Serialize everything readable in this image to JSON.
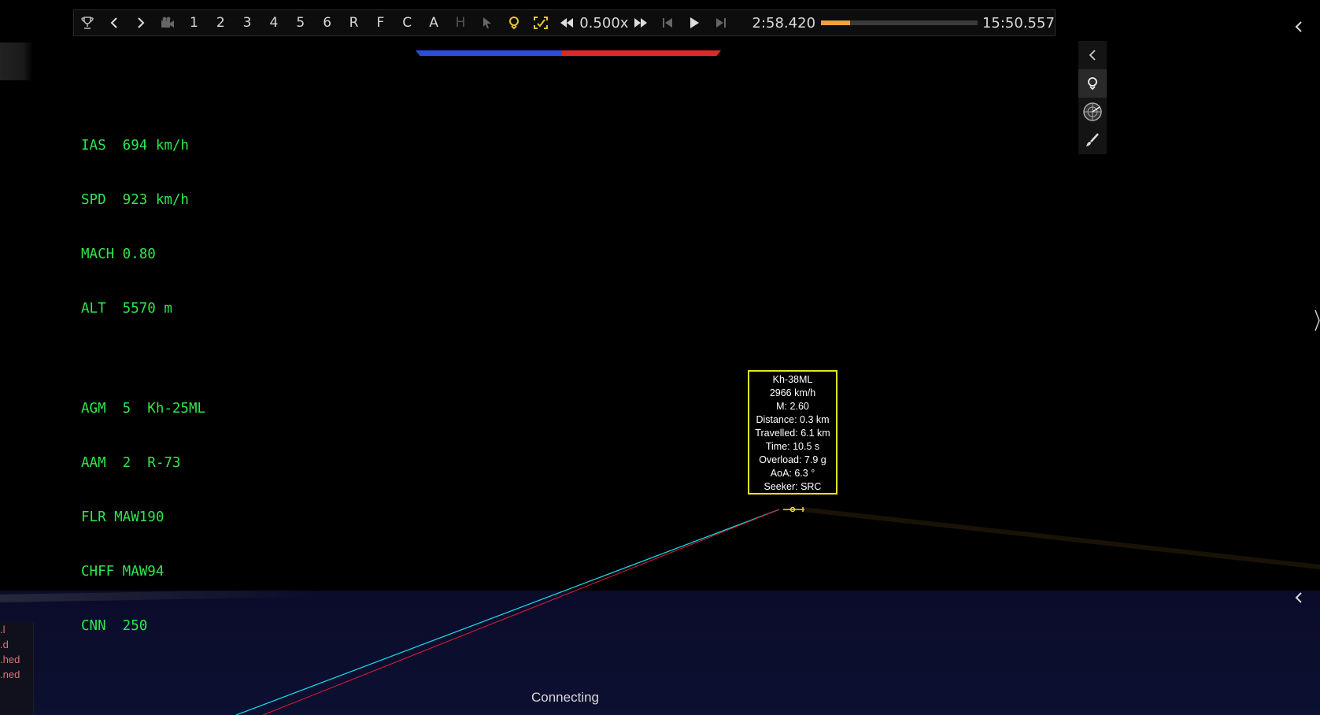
{
  "toolbar": {
    "icons": [
      "trophy-icon",
      "chevron-left-icon",
      "chevron-right-icon",
      "camera-icon"
    ],
    "keys": [
      "1",
      "2",
      "3",
      "4",
      "5",
      "6",
      "R",
      "F",
      "C",
      "A",
      "H"
    ],
    "speed": "0.500x",
    "time_current": "2:58.420",
    "time_end": "15:50.557",
    "progress": 0.187
  },
  "team_balance": {
    "blue": 0.48,
    "red": 0.52,
    "blue_color": "#2e4be0",
    "red_color": "#e02828"
  },
  "hud": {
    "flight": [
      "IAS  694 km/h",
      "SPD  923 km/h",
      "MACH 0.80",
      "ALT  5570 m"
    ],
    "weapons": [
      "AGM  5  Kh-25ML",
      "AAM  2  R-73",
      "FLR MAW190",
      "CHFF MAW94",
      "CNN  250"
    ],
    "color": "#2ee84e"
  },
  "tooltip": {
    "lines": [
      "Kh-38ML",
      "2966 km/h",
      "M: 2.60",
      "Distance: 0.3 km",
      "Travelled: 6.1 km",
      "Time: 10.5 s",
      "Overload: 7.9 g",
      "AoA: 6.3 °",
      "Seeker: SRC"
    ],
    "border_color": "#e8e41a"
  },
  "side_panel": {
    "buttons": [
      "chevron-left-icon",
      "map-pin-icon",
      "radar-icon",
      "brush-icon"
    ]
  },
  "log_lines": [
    "l.",
    "d.",
    "hed.",
    "ned."
  ],
  "status": "Connecting"
}
